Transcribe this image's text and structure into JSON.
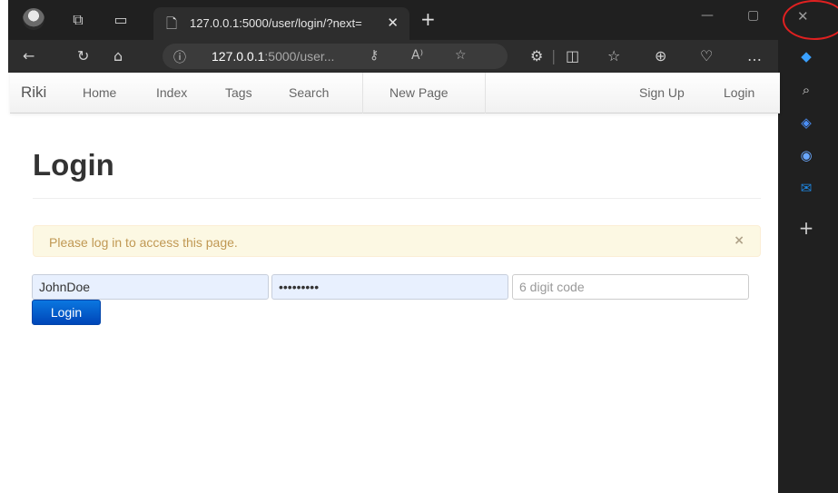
{
  "browser": {
    "tab_title": "127.0.0.1:5000/user/login/?next=",
    "url_host": "127.0.0.1",
    "url_rest": ":5000/user...",
    "icons": [
      "profile-avatar",
      "workspaces-icon",
      "tab-actions-icon",
      "page-icon",
      "close-icon",
      "new-tab-icon",
      "minimize-icon",
      "maximize-icon",
      "close-window-icon",
      "back-icon",
      "refresh-icon",
      "home-icon",
      "info-icon",
      "key-icon",
      "read-aloud-icon",
      "favorite-star-icon",
      "extensions-icon",
      "split-screen-icon",
      "favorites-icon",
      "collections-icon",
      "health-icon",
      "more-icon",
      "copilot-icon",
      "search-icon",
      "tag-icon",
      "office-icon",
      "outlook-icon",
      "add-icon"
    ]
  },
  "navbar": {
    "brand": "Riki",
    "links": [
      "Home",
      "Index",
      "Tags",
      "Search",
      "New Page"
    ],
    "right_links": [
      "Sign Up",
      "Login"
    ]
  },
  "page": {
    "title": "Login",
    "alert": "Please log in to access this page.",
    "alert_close": "×",
    "username_value": "JohnDoe",
    "password_value": "•••••••••",
    "code_placeholder": "6 digit code",
    "submit_label": "Login"
  },
  "colors": {
    "alert_bg": "#fcf8e3",
    "alert_text": "#c09853",
    "button": "#0a6fd8",
    "annotation": "#e02020"
  }
}
